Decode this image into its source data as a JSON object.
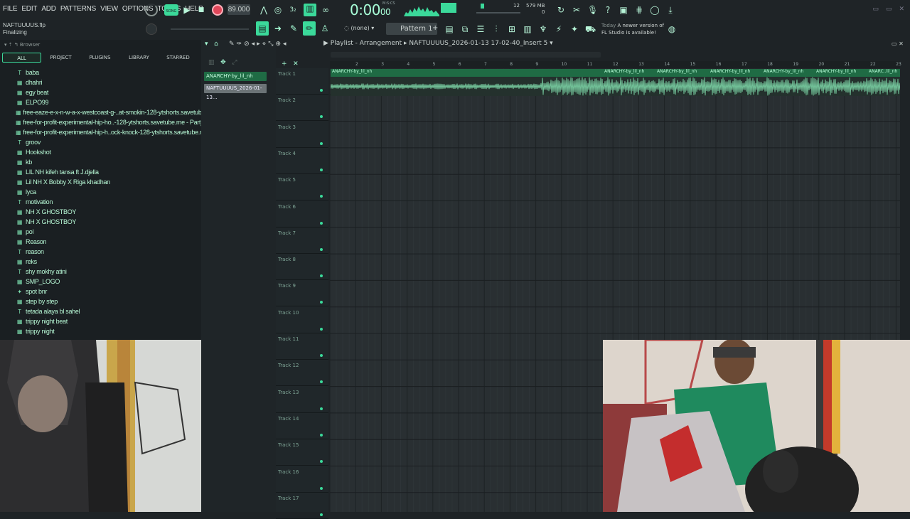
{
  "menu": [
    "FILE",
    "EDIT",
    "ADD",
    "PATTERNS",
    "VIEW",
    "OPTIONS",
    "TOOLS",
    "HELP"
  ],
  "transport": {
    "song_label": "SONG",
    "tempo": "89.000",
    "time_main": "0:00",
    "time_sub": "00",
    "time_unit": "M:S:CS"
  },
  "cpu_mem": {
    "line1": "579 MB",
    "line2": "0",
    "voices": "12"
  },
  "project": {
    "file": "NAFTUUUUS.flp",
    "status": "Finalizing"
  },
  "toolbar2": {
    "snap": "(none)",
    "pattern": "Pattern 1"
  },
  "news": {
    "when": "Today",
    "text1": "A newer version of",
    "text2": "FL Studio is available!"
  },
  "browser": {
    "title": "Browser",
    "tabs": [
      "ALL",
      "PROJECT",
      "PLUGINS",
      "LIBRARY",
      "STARRED"
    ],
    "items": [
      {
        "icon": "T",
        "label": "baba"
      },
      {
        "icon": "▦",
        "label": "dhahri"
      },
      {
        "icon": "▦",
        "label": "egy beat"
      },
      {
        "icon": "▦",
        "label": "ELPO99"
      },
      {
        "icon": "▦",
        "label": "free-eaze-e-x-n-w-a-x-westcoast-g-..at-smokin-128-ytshorts.savetube.me"
      },
      {
        "icon": "▦",
        "label": "free-for-profit-experimental-hip-ho..-128-ytshorts.savetube.me - Part_2"
      },
      {
        "icon": "▦",
        "label": "free-for-profit-experimental-hip-h..ock-knock-128-ytshorts.savetube.me"
      },
      {
        "icon": "T",
        "label": "groov"
      },
      {
        "icon": "▦",
        "label": "Hookshot"
      },
      {
        "icon": "▦",
        "label": "kb"
      },
      {
        "icon": "▦",
        "label": "LIL NH kifeh tansa ft J.djella"
      },
      {
        "icon": "▦",
        "label": "Lil NH X Bobby X Riga khadhan"
      },
      {
        "icon": "▦",
        "label": "lyca"
      },
      {
        "icon": "T",
        "label": "motivation"
      },
      {
        "icon": "▦",
        "label": "NH X GHOSTBOY"
      },
      {
        "icon": "▦",
        "label": "NH X GHOSTBOY"
      },
      {
        "icon": "▦",
        "label": "pol"
      },
      {
        "icon": "▦",
        "label": "Reason"
      },
      {
        "icon": "T",
        "label": "reason"
      },
      {
        "icon": "▦",
        "label": "reks"
      },
      {
        "icon": "T",
        "label": "shy mokhy atini"
      },
      {
        "icon": "▦",
        "label": "SMP_LOGO"
      },
      {
        "icon": "✦",
        "label": "spot bnr"
      },
      {
        "icon": "▦",
        "label": "step by step"
      },
      {
        "icon": "T",
        "label": "tetada alaya bl sahel"
      },
      {
        "icon": "▦",
        "label": "trippy night beat"
      },
      {
        "icon": "▦",
        "label": "trippy night"
      }
    ]
  },
  "picker": {
    "clips": [
      "ANARCHY-by_lil_nh",
      "NAFTUUUUS_2026-01-13..."
    ]
  },
  "playlist": {
    "title": "Playlist - Arrangement",
    "pattern": "NAFTUUUUS_2026-01-13 17-02-40_Insert 5",
    "ruler": [
      "2",
      "3",
      "4",
      "5",
      "6",
      "7",
      "8",
      "9",
      "10",
      "11",
      "12",
      "13",
      "14",
      "15",
      "16",
      "17",
      "18",
      "19",
      "20",
      "21",
      "22",
      "23"
    ],
    "clip_labels": [
      "ANARCHY-by_lil_nh",
      "ANARCHY-by_lil_nh",
      "ANARCHY-by_lil_nh",
      "ANARCHY-by_lil_nh",
      "ANARCHY-by_lil_nh",
      "ANARCHY-by_lil_nh",
      "ANARC..lil_nh"
    ],
    "tracks": [
      "Track 1",
      "Track 2",
      "Track 3",
      "Track 4",
      "Track 5",
      "Track 6",
      "Track 7",
      "Track 8",
      "Track 9",
      "Track 10",
      "Track 11",
      "Track 12",
      "Track 13",
      "Track 14",
      "Track 15",
      "Track 16",
      "Track 17"
    ]
  },
  "colors": {
    "accent": "#3bd99a",
    "background": "#1e2326",
    "clip": "#1f6b44",
    "text_green": "#b6f7d4"
  },
  "icons": [
    "record-icon",
    "play-icon",
    "stop-icon",
    "metronome-icon",
    "mixer-icon",
    "piano-roll-icon",
    "channel-rack-icon",
    "browser-icon",
    "plugin-icon",
    "undo-icon",
    "help-icon",
    "save-icon",
    "export-icon"
  ]
}
